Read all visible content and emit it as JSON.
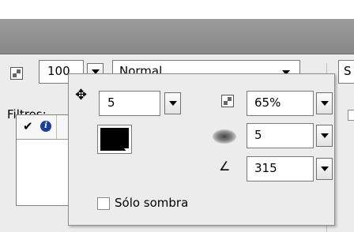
{
  "toolbar": {
    "opacity_value": "100",
    "blend_mode": "Normal",
    "right_partial_label": "S"
  },
  "filters": {
    "label": "Filtros:"
  },
  "shadow_popup": {
    "distance": "5",
    "alpha": "65%",
    "blur": "5",
    "angle": "315",
    "color": "#000000",
    "shadow_only_label": "Sólo sombra",
    "shadow_only_checked": false
  },
  "icons": [
    "move-icon",
    "transparency-icon",
    "blur-icon",
    "angle-icon",
    "check-icon",
    "info-icon"
  ]
}
